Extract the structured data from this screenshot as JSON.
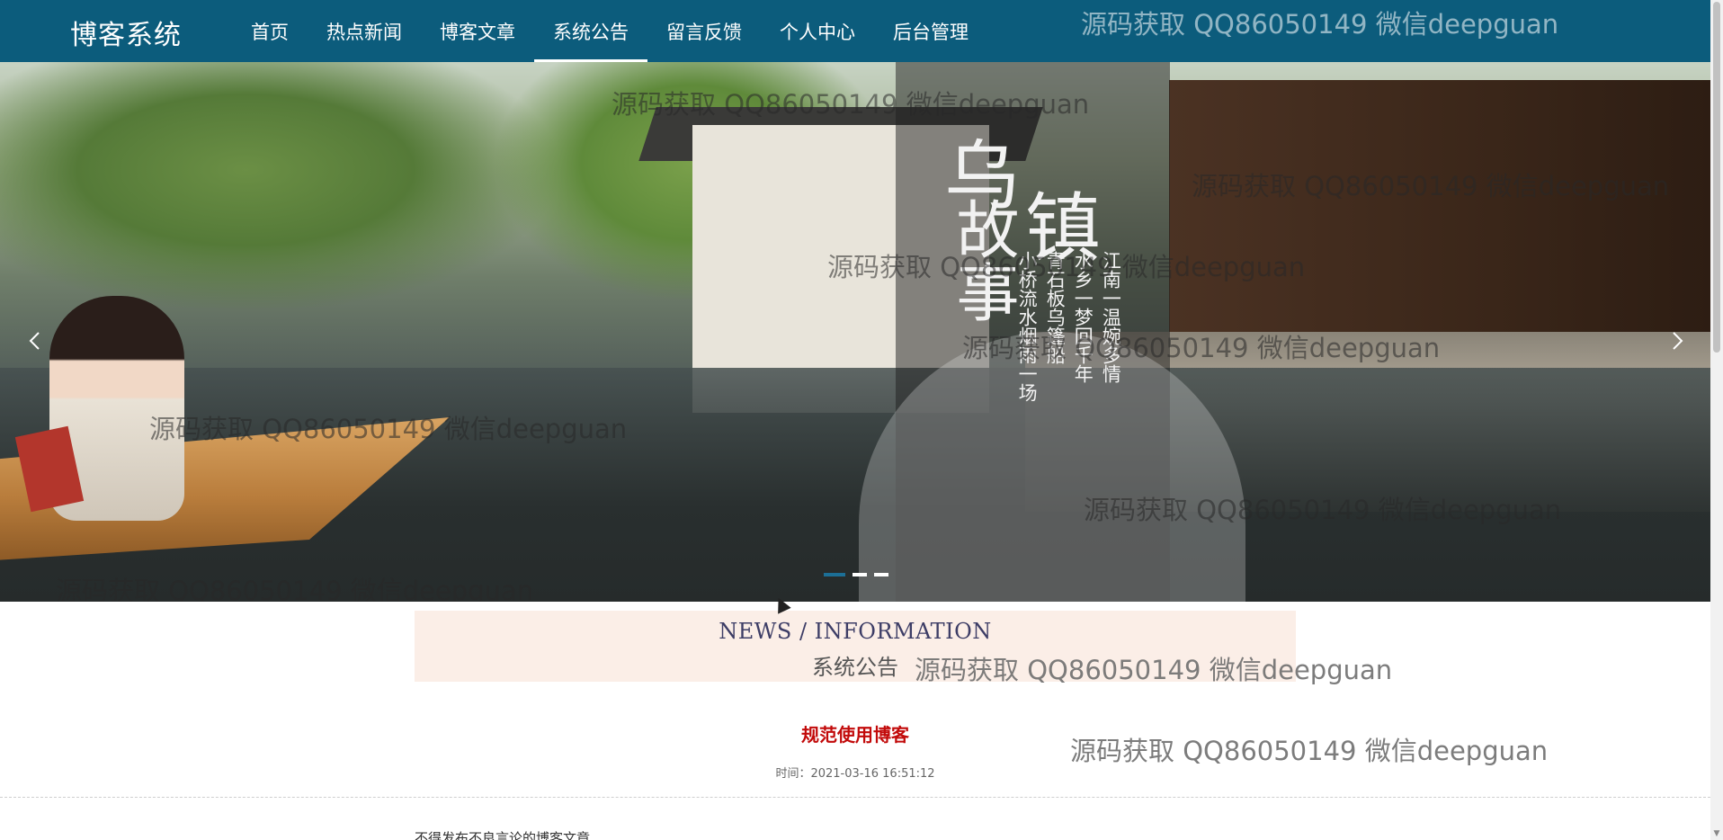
{
  "brand": "博客系统",
  "nav": {
    "items": [
      {
        "label": "首页"
      },
      {
        "label": "热点新闻"
      },
      {
        "label": "博客文章"
      },
      {
        "label": "系统公告"
      },
      {
        "label": "留言反馈"
      },
      {
        "label": "个人中心"
      },
      {
        "label": "后台管理"
      }
    ],
    "active": "系统公告"
  },
  "banner": {
    "title_chars": [
      "乌",
      "镇",
      "故",
      "事"
    ],
    "poem_lines": [
      "江南一温婉多情",
      "水乡一梦回千年",
      "青石板乌篷船",
      "小桥流水烟雨一场"
    ],
    "prev_icon": "chevron-left-icon",
    "next_icon": "chevron-right-icon",
    "slide_count": 3,
    "active_slide": 1
  },
  "section": {
    "en_title": "NEWS / INFORMATION",
    "cn_title": "系统公告"
  },
  "article": {
    "title": "规范使用博客",
    "time_label": "时间：",
    "time": "2021-03-16 16:51:12",
    "body": "不得发布不良言论的博客文章"
  },
  "watermark": "源码获取 QQ86050149 微信deepguan",
  "colors": {
    "nav_bg": "#0c5c7c",
    "section_bg": "#fbeee7",
    "article_title": "#c20a0a",
    "active_dot": "#1c6f96"
  }
}
